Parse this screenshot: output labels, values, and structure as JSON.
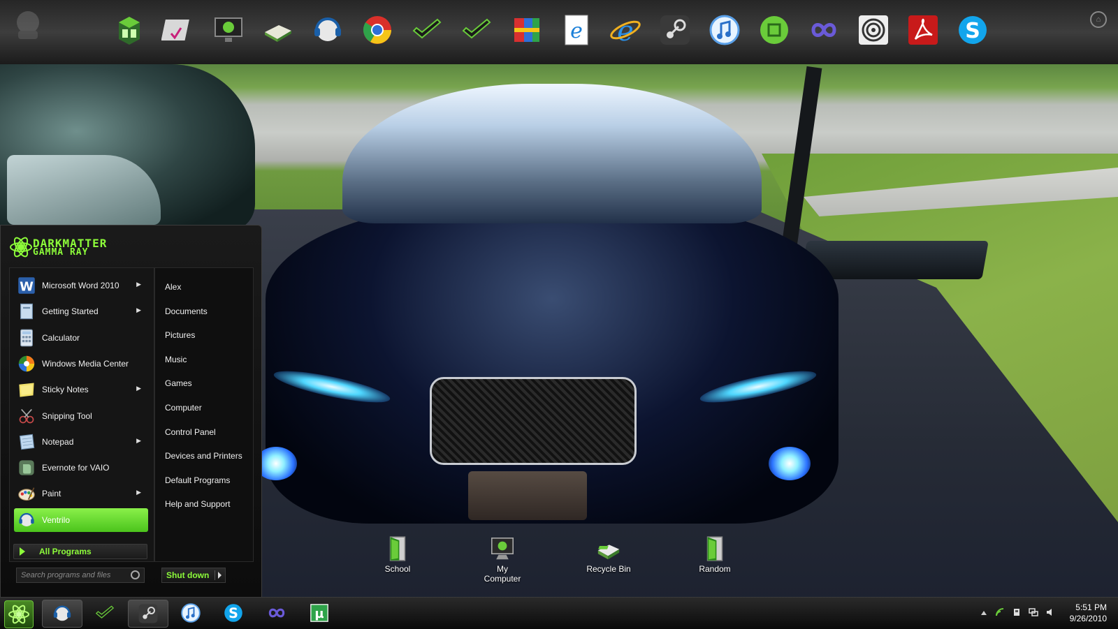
{
  "dock": {
    "icons": [
      {
        "name": "pda-cube-icon"
      },
      {
        "name": "checklist-icon"
      },
      {
        "name": "monitor-icon"
      },
      {
        "name": "folder-book-icon"
      },
      {
        "name": "ventrilo-headset-icon"
      },
      {
        "name": "chrome-icon"
      },
      {
        "name": "utorrent-check-icon"
      },
      {
        "name": "check-dark-icon"
      },
      {
        "name": "winrar-stack-icon"
      },
      {
        "name": "ie-document-icon"
      },
      {
        "name": "internet-explorer-icon"
      },
      {
        "name": "steam-icon"
      },
      {
        "name": "itunes-icon"
      },
      {
        "name": "green-circle-icon"
      },
      {
        "name": "infinity-icon"
      },
      {
        "name": "spiral-icon"
      },
      {
        "name": "acrobat-icon"
      },
      {
        "name": "skype-icon"
      }
    ]
  },
  "start_menu": {
    "logo": {
      "line1": "DARKMATTER",
      "line2": "GAMMA RAY"
    },
    "programs": [
      {
        "label": "Microsoft Word 2010",
        "has_arrow": true,
        "icon": "word-icon",
        "color": "#2b5faa"
      },
      {
        "label": "Getting Started",
        "has_arrow": true,
        "icon": "getting-started-icon",
        "color": "#6b8aa8"
      },
      {
        "label": "Calculator",
        "has_arrow": false,
        "icon": "calculator-icon",
        "color": "#8aa0b8"
      },
      {
        "label": "Windows Media Center",
        "has_arrow": false,
        "icon": "media-center-icon",
        "color": "#3aa83a"
      },
      {
        "label": "Sticky Notes",
        "has_arrow": true,
        "icon": "sticky-notes-icon",
        "color": "#e8d84a"
      },
      {
        "label": "Snipping Tool",
        "has_arrow": false,
        "icon": "snipping-tool-icon",
        "color": "#c84a4a"
      },
      {
        "label": "Notepad",
        "has_arrow": true,
        "icon": "notepad-icon",
        "color": "#7aa8c8"
      },
      {
        "label": "Evernote for VAIO",
        "has_arrow": false,
        "icon": "evernote-icon",
        "color": "#6a8a6a"
      },
      {
        "label": "Paint",
        "has_arrow": true,
        "icon": "paint-icon",
        "color": "#d8a84a"
      },
      {
        "label": "Ventrilo",
        "has_arrow": false,
        "icon": "ventrilo-icon",
        "color": "#cfcfcf",
        "selected": true
      }
    ],
    "places": [
      "Alex",
      "Documents",
      "Pictures",
      "Music",
      "Games",
      "Computer",
      "Control Panel",
      "Devices and Printers",
      "Default Programs",
      "Help and Support"
    ],
    "all_programs_label": "All Programs",
    "search_placeholder": "Search programs and files",
    "shutdown_label": "Shut down"
  },
  "desktop": {
    "icons": [
      {
        "label": "School",
        "icon": "green-door-icon"
      },
      {
        "label": "My Computer",
        "icon": "computer-icon"
      },
      {
        "label": "Recycle Bin",
        "icon": "recycle-bin-icon"
      },
      {
        "label": "Random",
        "icon": "green-door-icon"
      }
    ]
  },
  "taskbar": {
    "buttons": [
      {
        "name": "ventrilo-icon",
        "active": true
      },
      {
        "name": "utorrent-check-icon",
        "active": false
      },
      {
        "name": "steam-icon",
        "active": true
      },
      {
        "name": "itunes-icon",
        "active": false
      },
      {
        "name": "skype-icon",
        "active": false
      },
      {
        "name": "infinity-icon",
        "active": false
      },
      {
        "name": "utorrent-icon",
        "active": false
      }
    ],
    "tray_icons": [
      "show-hidden-icon",
      "network-signal-icon",
      "device-icon",
      "network-icon",
      "volume-icon"
    ],
    "time": "5:51 PM",
    "date": "9/26/2010"
  },
  "colors": {
    "accent_green": "#8dfc3a",
    "selected_green": "#5cd42a"
  }
}
